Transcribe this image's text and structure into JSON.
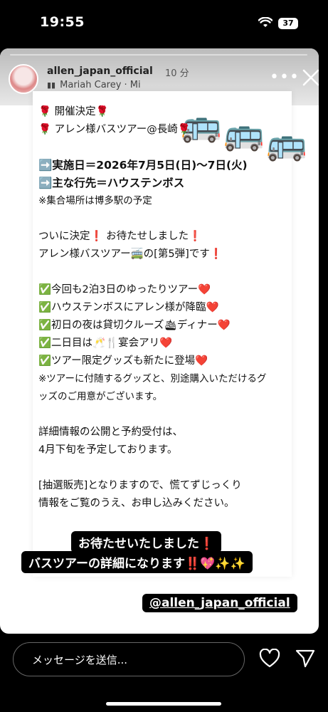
{
  "status_bar": {
    "time": "19:55",
    "battery": "37"
  },
  "story": {
    "username": "allen_japan_official",
    "time_ago": "10 分",
    "music": "Mariah Carey · Mi",
    "progress_fraction": 1.0
  },
  "post": {
    "lines": [
      "🌹 開催決定🌹",
      "🌹 アレン様バスツアー@長崎🌹",
      "",
      "➡️実施日＝2026年7月5日(日)〜7日(火)",
      "➡️主な行先＝ハウステンボス",
      "※集合場所は博多駅の予定",
      "",
      "ついに決定❗️ お待たせしました❗️",
      "アレン様バスツアー🚎の[第5弾]です❗️",
      "",
      "✅今回も2泊3日のゆったりツアー❤️",
      "✅ハウステンボスにアレン様が降臨❤️",
      "✅初日の夜は貸切クルーズ🛳ディナー❤️",
      "✅二日目は🥂🍴宴会アリ❤️",
      "✅ツアー限定グッズも新たに登場❤️",
      "※ツアーに付随するグッズと、別途購入いただけるグ",
      "ッズのご用意がございます。",
      "",
      "詳細情報の公開と予約受付は、",
      "4月下旬を予定しております。",
      "",
      "[抽選販売]となりますので、慌てずじっくり",
      "情報をご覧のうえ、お申し込みください。"
    ]
  },
  "captions": {
    "line1": "お待たせいたしました❗️",
    "line2": "バスツアーの詳細になります‼️💖✨✨",
    "mention": "@allen_japan_official"
  },
  "reply": {
    "placeholder": "メッセージを送信..."
  },
  "icons": {
    "music": "music-icon",
    "more": "more-icon",
    "close": "close-icon",
    "like": "heart-icon",
    "share": "send-icon",
    "sticker": "bus-sticker"
  }
}
